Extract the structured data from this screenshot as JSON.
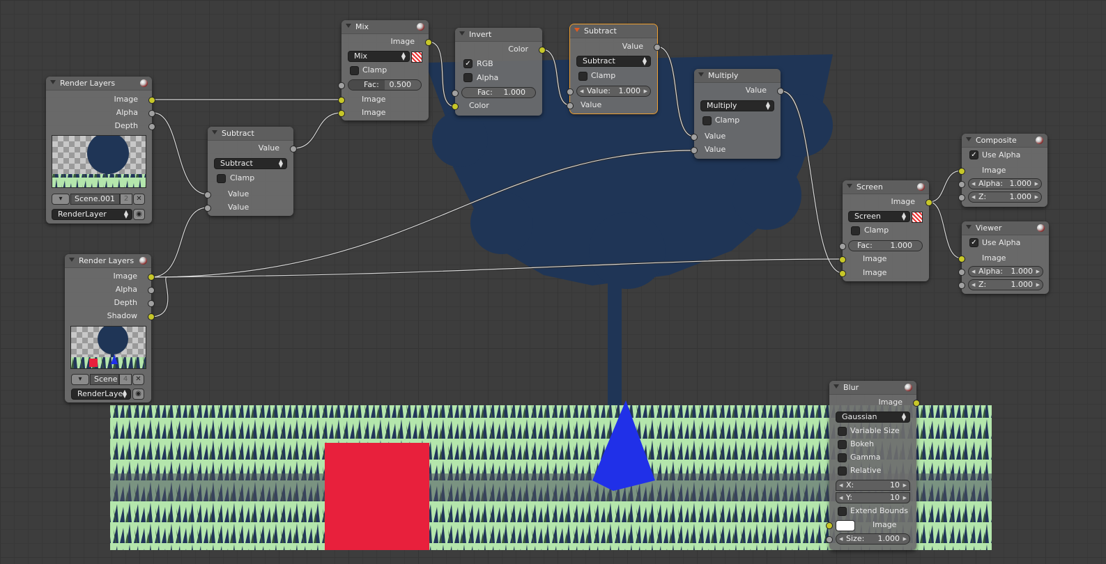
{
  "colors": {
    "socket_image": "#c7c729",
    "socket_value": "#a1a1a1",
    "node_body": "#6c6c6c",
    "selected_outline": "#f0a030",
    "tree": "#1f3556",
    "grass_light": "#b8eab0",
    "cube": "#e8203c",
    "cone": "#2030e8",
    "ground": "#4a4f5e"
  },
  "nodes": {
    "render1": {
      "title": "Render Layers",
      "outputs": [
        "Image",
        "Alpha",
        "Depth"
      ],
      "scene": "Scene.001",
      "scene_users": "2",
      "layer": "RenderLayer"
    },
    "render2": {
      "title": "Render Layers",
      "outputs": [
        "Image",
        "Alpha",
        "Depth",
        "Shadow"
      ],
      "scene": "Scene",
      "scene_users": "4",
      "layer": "RenderLayer"
    },
    "subtract1": {
      "title": "Subtract",
      "output": "Value",
      "op": "Subtract",
      "clamp": "Clamp",
      "inputs": [
        "Value",
        "Value"
      ]
    },
    "mix": {
      "title": "Mix",
      "output": "Image",
      "op": "Mix",
      "clamp": "Clamp",
      "fac_label": "Fac:",
      "fac_value": "0.500",
      "fac_fraction": 0.5,
      "inputs": [
        "Image",
        "Image"
      ]
    },
    "invert": {
      "title": "Invert",
      "output": "Color",
      "rgb": "RGB",
      "alpha": "Alpha",
      "fac_label": "Fac:",
      "fac_value": "1.000",
      "input": "Color"
    },
    "subtract2": {
      "title": "Subtract",
      "output": "Value",
      "op": "Subtract",
      "clamp": "Clamp",
      "value_label": "Value:",
      "value_value": "1.000",
      "input": "Value"
    },
    "multiply": {
      "title": "Multiply",
      "output": "Value",
      "op": "Multiply",
      "clamp": "Clamp",
      "inputs": [
        "Value",
        "Value"
      ]
    },
    "screen": {
      "title": "Screen",
      "output": "Image",
      "op": "Screen",
      "clamp": "Clamp",
      "fac_label": "Fac:",
      "fac_value": "1.000",
      "inputs": [
        "Image",
        "Image"
      ]
    },
    "composite": {
      "title": "Composite",
      "use_alpha": "Use Alpha",
      "input": "Image",
      "alpha_label": "Alpha:",
      "alpha_value": "1.000",
      "z_label": "Z:",
      "z_value": "1.000"
    },
    "viewer": {
      "title": "Viewer",
      "use_alpha": "Use Alpha",
      "input": "Image",
      "alpha_label": "Alpha:",
      "alpha_value": "1.000",
      "z_label": "Z:",
      "z_value": "1.000"
    },
    "blur": {
      "title": "Blur",
      "output": "Image",
      "filter": "Gaussian",
      "options": [
        "Variable Size",
        "Bokeh",
        "Gamma",
        "Relative"
      ],
      "x_label": "X:",
      "x_value": "10",
      "y_label": "Y:",
      "y_value": "10",
      "extend": "Extend Bounds",
      "input": "Image",
      "size_label": "Size:",
      "size_value": "1.000"
    }
  }
}
